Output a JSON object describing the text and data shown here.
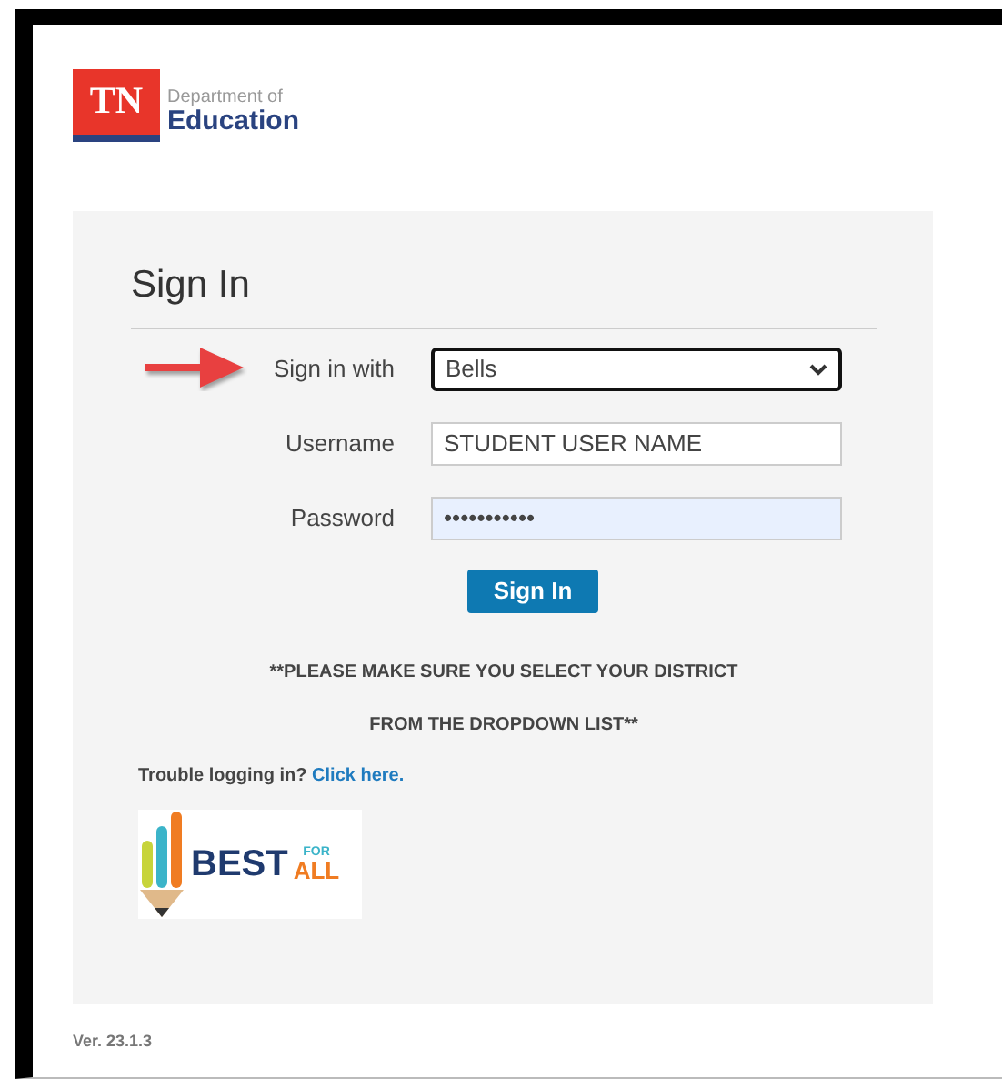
{
  "logo": {
    "mark": "TN",
    "line_1": "Department of",
    "line_2": "Education"
  },
  "form": {
    "title": "Sign In",
    "fields": [
      {
        "label": "Sign in with",
        "kind": "select",
        "value": "Bells",
        "focused": true,
        "autofilled": false,
        "pointer": true
      },
      {
        "label": "Username",
        "kind": "text",
        "value": "STUDENT USER NAME",
        "focused": false,
        "autofilled": false,
        "pointer": false
      },
      {
        "label": "Password",
        "kind": "text",
        "value": "•••••••••••",
        "focused": false,
        "autofilled": true,
        "pointer": false
      }
    ],
    "button": "Sign In",
    "notice": [
      "**PLEASE MAKE SURE YOU SELECT YOUR DISTRICT",
      "FROM THE DROPDOWN LIST**"
    ],
    "help": {
      "text": "Trouble logging in?",
      "link": "Click here."
    },
    "badge": {
      "word": "BEST",
      "small": "FOR",
      "big": "ALL"
    }
  },
  "version": "Ver. 23.1.3"
}
